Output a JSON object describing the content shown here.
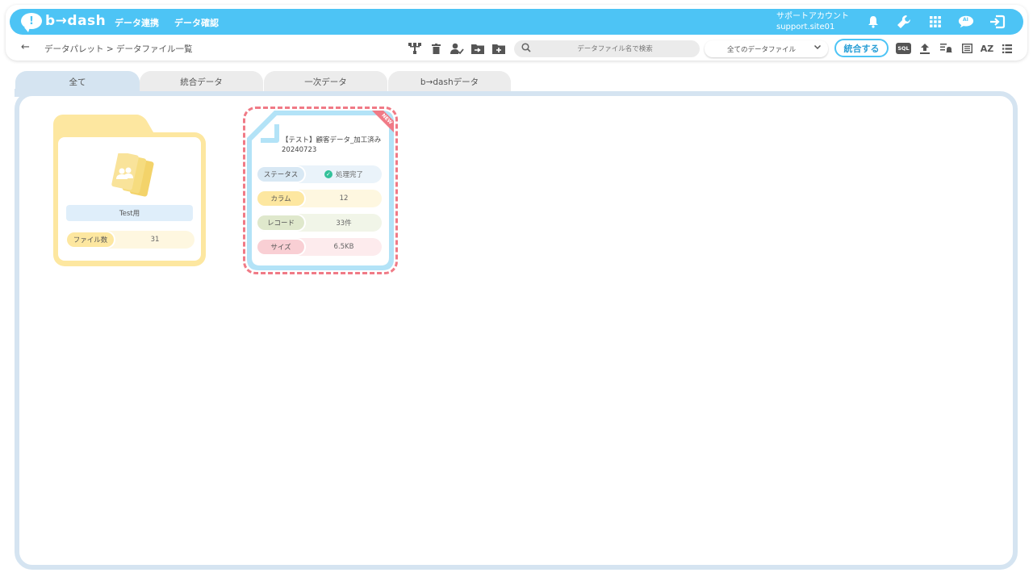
{
  "header": {
    "logo_glyph": "!",
    "logo_text": "b→dash",
    "nav": [
      {
        "label": "データ連携"
      },
      {
        "label": "データ確認"
      }
    ],
    "account": {
      "line1": "サポートアカウント",
      "line2": "support.site01"
    },
    "icons": [
      "bell-icon",
      "wrench-icon",
      "apps-grid-icon",
      "ai-bubble-icon",
      "logout-icon"
    ],
    "ai_badge": "AI",
    "accent_color": "#4dc4f5"
  },
  "toolbar": {
    "back_glyph": "←",
    "breadcrumb": "データパレット > データファイル一覧",
    "search": {
      "placeholder": "データファイル名で検索",
      "value": ""
    },
    "filter": {
      "selected": "全てのデータファイル"
    },
    "merge_label": "統合する",
    "sql_label": "SQL",
    "sort_label": "AZ"
  },
  "tabs": [
    {
      "label": "全て",
      "active": true
    },
    {
      "label": "統合データ",
      "active": false
    },
    {
      "label": "一次データ",
      "active": false
    },
    {
      "label": "b→dashデータ",
      "active": false
    }
  ],
  "folder": {
    "name": "Test用",
    "count_label": "ファイル数",
    "count_value": "31",
    "color": "#fde7a0"
  },
  "file": {
    "title": "【テスト】顧客データ_加工済み20240723",
    "badge": "NEW",
    "rows": [
      {
        "label": "ステータス",
        "value": "処理完了"
      },
      {
        "label": "カラム",
        "value": "12"
      },
      {
        "label": "レコード",
        "value": "33件"
      },
      {
        "label": "サイズ",
        "value": "6.5KB"
      }
    ],
    "status_color": "#33c19a",
    "highlight_color": "#f07a86"
  }
}
